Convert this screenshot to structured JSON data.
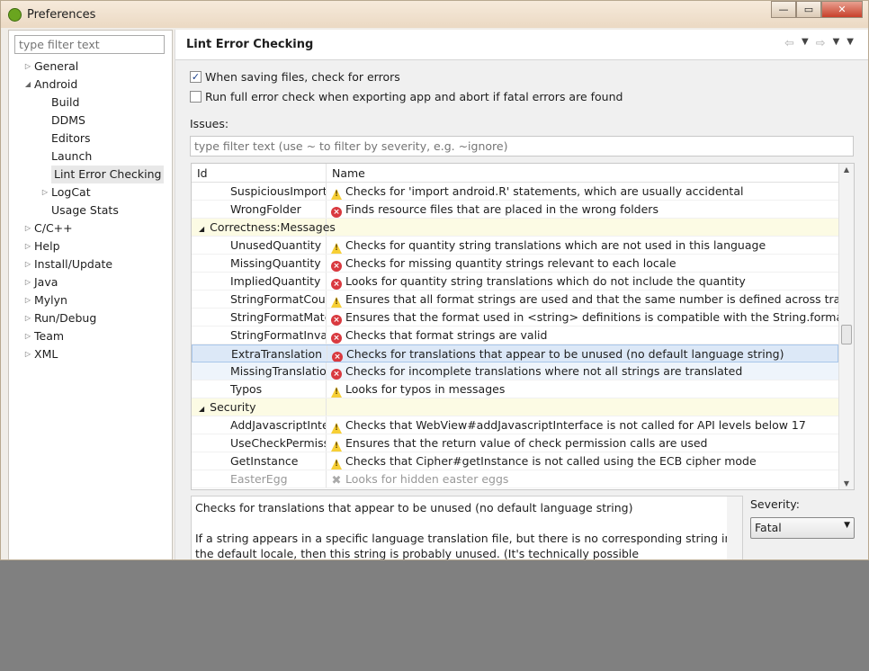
{
  "window": {
    "title": "Preferences",
    "minimize": "—",
    "maximize": "▭",
    "close": "✕"
  },
  "left": {
    "filter_placeholder": "type filter text",
    "tree": [
      {
        "label": "General",
        "level": 0,
        "twisty": "▷"
      },
      {
        "label": "Android",
        "level": 0,
        "twisty": "◢"
      },
      {
        "label": "Build",
        "level": 1,
        "twisty": ""
      },
      {
        "label": "DDMS",
        "level": 1,
        "twisty": ""
      },
      {
        "label": "Editors",
        "level": 1,
        "twisty": ""
      },
      {
        "label": "Launch",
        "level": 1,
        "twisty": ""
      },
      {
        "label": "Lint Error Checking",
        "level": 1,
        "twisty": "",
        "selected": true
      },
      {
        "label": "LogCat",
        "level": 1,
        "twisty": "▷"
      },
      {
        "label": "Usage Stats",
        "level": 1,
        "twisty": ""
      },
      {
        "label": "C/C++",
        "level": 0,
        "twisty": "▷"
      },
      {
        "label": "Help",
        "level": 0,
        "twisty": "▷"
      },
      {
        "label": "Install/Update",
        "level": 0,
        "twisty": "▷"
      },
      {
        "label": "Java",
        "level": 0,
        "twisty": "▷"
      },
      {
        "label": "Mylyn",
        "level": 0,
        "twisty": "▷"
      },
      {
        "label": "Run/Debug",
        "level": 0,
        "twisty": "▷"
      },
      {
        "label": "Team",
        "level": 0,
        "twisty": "▷"
      },
      {
        "label": "XML",
        "level": 0,
        "twisty": "▷"
      }
    ]
  },
  "page": {
    "title": "Lint Error Checking",
    "check_on_save": {
      "label": "When saving files, check for errors",
      "checked": true
    },
    "full_check": {
      "label": "Run full error check when exporting app and abort if fatal errors are found",
      "checked": false
    },
    "issues_label": "Issues:",
    "issues_filter_placeholder": "type filter text (use ~ to filter by severity, e.g. ~ignore)",
    "columns": [
      "Id",
      "Name"
    ],
    "rows": [
      {
        "id": "SuspiciousImport",
        "severity": "warning",
        "name": "Checks for 'import android.R' statements, which are usually accidental"
      },
      {
        "id": "WrongFolder",
        "severity": "error",
        "name": "Finds resource files that are placed in the wrong folders"
      },
      {
        "category": "Correctness:Messages"
      },
      {
        "id": "UnusedQuantity",
        "severity": "warning",
        "name": "Checks for quantity string translations which are not used in this language"
      },
      {
        "id": "MissingQuantity",
        "severity": "error",
        "name": "Checks for missing quantity strings relevant to each locale"
      },
      {
        "id": "ImpliedQuantity",
        "severity": "error",
        "name": "Looks for quantity string translations which do not include the quantity"
      },
      {
        "id": "StringFormatCount",
        "severity": "warning",
        "name": "Ensures that all format strings are used and that the same number is defined across transla…"
      },
      {
        "id": "StringFormatMatches",
        "severity": "error",
        "name": "Ensures that the format used in <string> definitions is compatible with the String.format call"
      },
      {
        "id": "StringFormatInvalid",
        "severity": "error",
        "name": "Checks that format strings are valid"
      },
      {
        "id": "ExtraTranslation",
        "severity": "error",
        "name": "Checks for translations that appear to be unused (no default language string)",
        "selected": true
      },
      {
        "id": "MissingTranslation",
        "severity": "error",
        "name": "Checks for incomplete translations where not all strings are translated",
        "hover": true
      },
      {
        "id": "Typos",
        "severity": "warning",
        "name": "Looks for typos in messages"
      },
      {
        "category": "Security"
      },
      {
        "id": "AddJavascriptInterface",
        "severity": "warning",
        "name": "Checks that WebView#addJavascriptInterface is not called for API levels below 17"
      },
      {
        "id": "UseCheckPermission",
        "severity": "warning",
        "name": "Ensures that the return value of check permission calls are used"
      },
      {
        "id": "GetInstance",
        "severity": "warning",
        "name": "Checks that Cipher#getInstance is not called using the ECB cipher mode"
      },
      {
        "id": "EasterEgg",
        "severity": "ignore",
        "name": "Looks for hidden easter eggs"
      }
    ],
    "description": {
      "summary": "Checks for translations that appear to be unused (no default language string)",
      "body": "If a string appears in a specific language translation file, but there is no corresponding string in the default locale, then this string is probably unused. (It's technically possible"
    },
    "severity_label": "Severity:",
    "severity_value": "Fatal"
  },
  "colors": {
    "warning": "#f7cf35",
    "error": "#d9393f",
    "selection": "#dce8f7",
    "category_bg": "#fcfbe4"
  }
}
